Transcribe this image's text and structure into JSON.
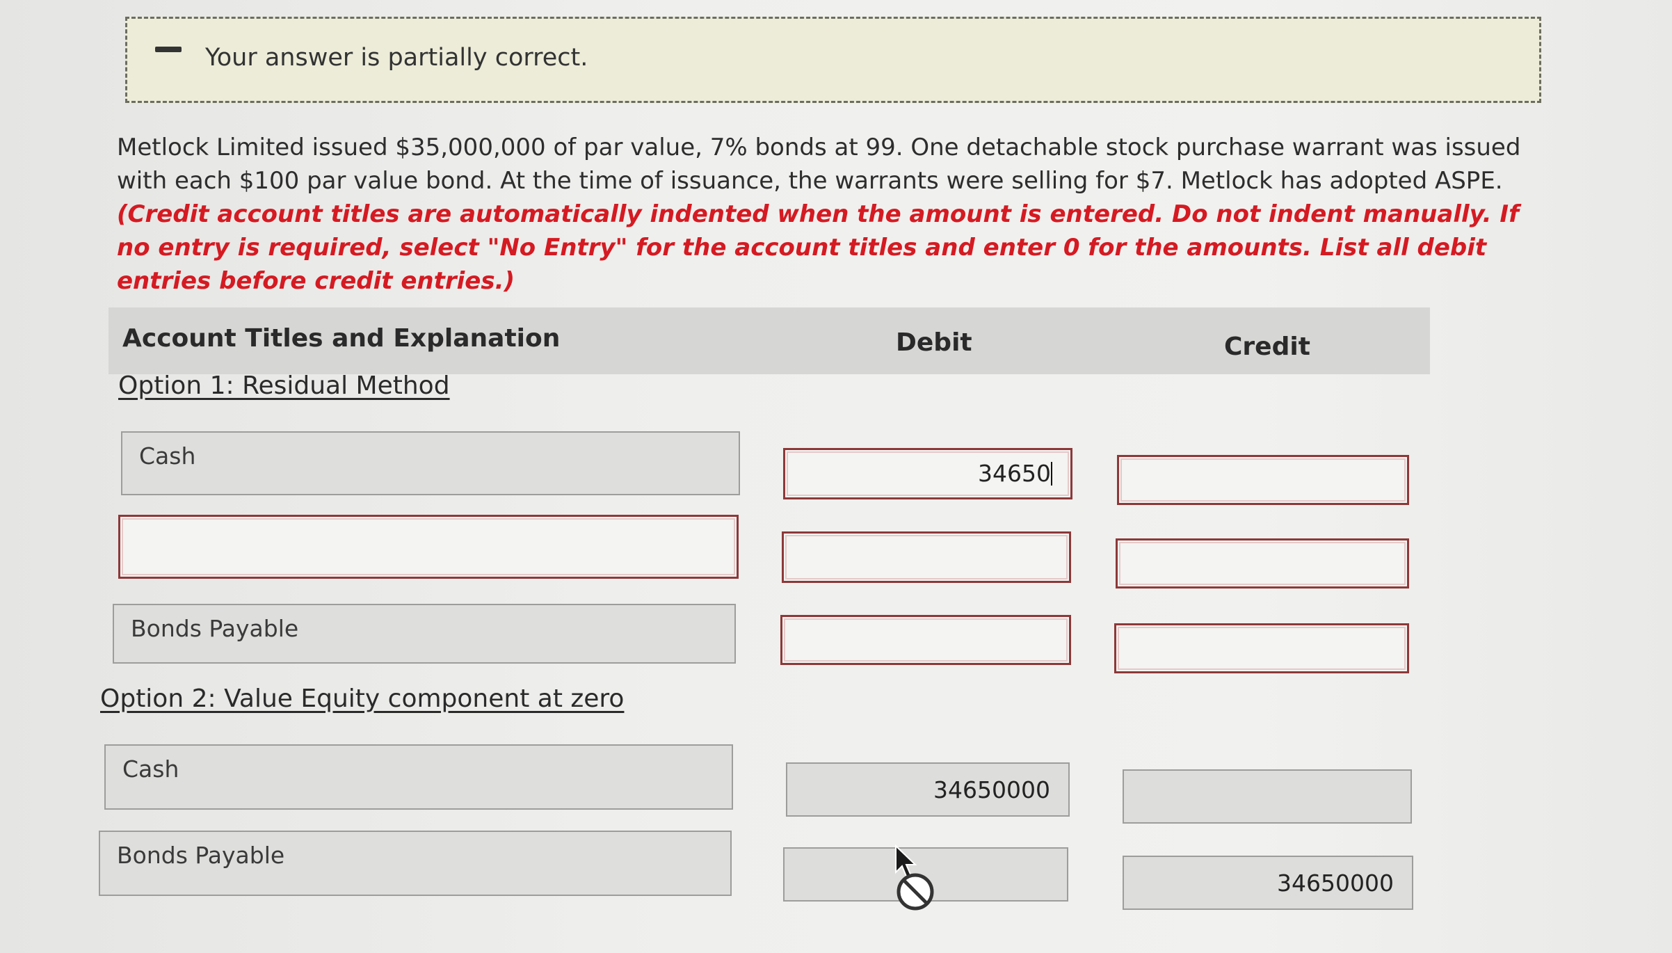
{
  "feedback": {
    "message": "Your answer is partially correct."
  },
  "problem": {
    "statement": "Metlock Limited issued $35,000,000 of par value, 7% bonds at 99. One detachable stock purchase warrant was issued with each $100 par value bond. At the time of issuance, the warrants were selling for $7. Metlock has adopted ASPE. ",
    "instructions": "(Credit account titles are automatically indented when the amount is entered. Do not indent manually. If no entry is required, select \"No Entry\" for the account titles and enter 0 for the amounts. List all debit entries before credit entries.)"
  },
  "table": {
    "headers": {
      "account": "Account Titles and Explanation",
      "debit": "Debit",
      "credit": "Credit"
    }
  },
  "option1": {
    "heading": "Option 1: Residual Method",
    "rows": [
      {
        "account": "Cash",
        "debit": "34650",
        "credit": ""
      },
      {
        "account": "",
        "debit": "",
        "credit": ""
      },
      {
        "account": "Bonds Payable",
        "debit": "",
        "credit": ""
      }
    ]
  },
  "option2": {
    "heading": "Option 2: Value Equity component at zero",
    "rows": [
      {
        "account": "Cash",
        "debit": "34650000",
        "credit": ""
      },
      {
        "account": "Bonds Payable",
        "debit": "",
        "credit": "34650000"
      }
    ]
  },
  "icons": {
    "feedback": "minus-icon",
    "cursor": "mouse-pointer-icon",
    "not_allowed": "not-allowed-icon"
  }
}
